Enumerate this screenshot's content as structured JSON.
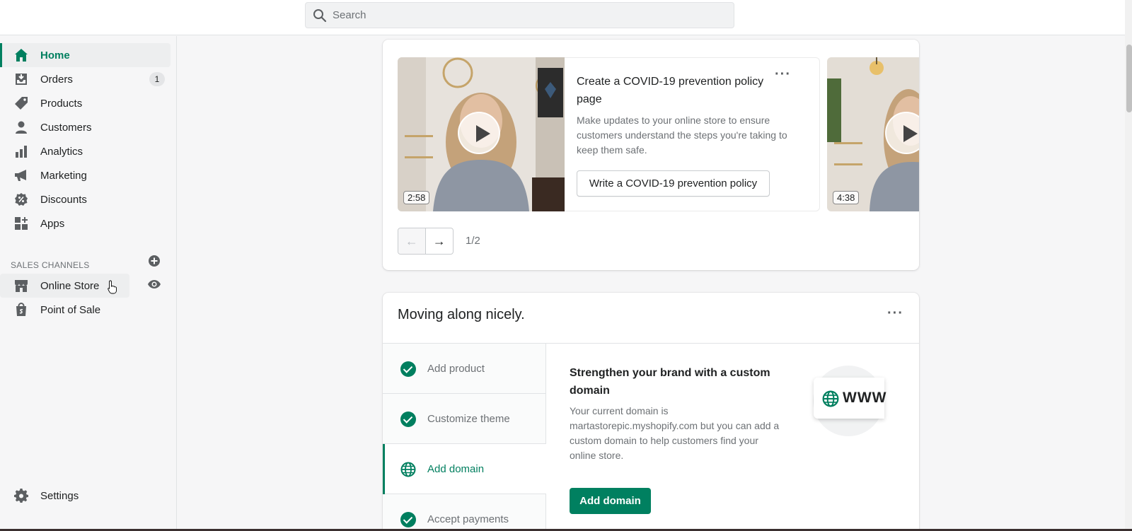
{
  "search": {
    "placeholder": "Search"
  },
  "sidebar": {
    "items": [
      {
        "label": "Home",
        "icon": "home-icon",
        "active": true
      },
      {
        "label": "Orders",
        "icon": "orders-icon",
        "badge": "1"
      },
      {
        "label": "Products",
        "icon": "tag-icon"
      },
      {
        "label": "Customers",
        "icon": "person-icon"
      },
      {
        "label": "Analytics",
        "icon": "bar-chart-icon"
      },
      {
        "label": "Marketing",
        "icon": "megaphone-icon"
      },
      {
        "label": "Discounts",
        "icon": "discount-icon"
      },
      {
        "label": "Apps",
        "icon": "apps-icon"
      }
    ],
    "sales_channels_heading": "SALES CHANNELS",
    "channels": [
      {
        "label": "Online Store",
        "icon": "store-icon"
      },
      {
        "label": "Point of Sale",
        "icon": "shopping-bag-icon"
      }
    ],
    "settings_label": "Settings"
  },
  "video_card": {
    "video1_duration": "2:58",
    "video2_duration": "4:38",
    "title": "Create a COVID-19 prevention policy page",
    "body": "Make updates to your online store to ensure customers understand the steps you're taking to keep them safe.",
    "button_label": "Write a COVID-19 prevention policy",
    "page_indicator": "1/2"
  },
  "setup_card": {
    "title": "Moving along nicely.",
    "steps": [
      {
        "label": "Add product",
        "done": true
      },
      {
        "label": "Customize theme",
        "done": true
      },
      {
        "label": "Add domain",
        "done": false,
        "current": true
      },
      {
        "label": "Accept payments",
        "done": true
      }
    ],
    "detail_title": "Strengthen your brand with a custom domain",
    "detail_body": "Your current domain is martastorepic.myshopify.com but you can add a custom domain to help customers find your online store.",
    "button_label": "Add domain",
    "illustration_text": "WWW"
  },
  "colors": {
    "accent": "#008060",
    "active_text": "#007f5f"
  }
}
